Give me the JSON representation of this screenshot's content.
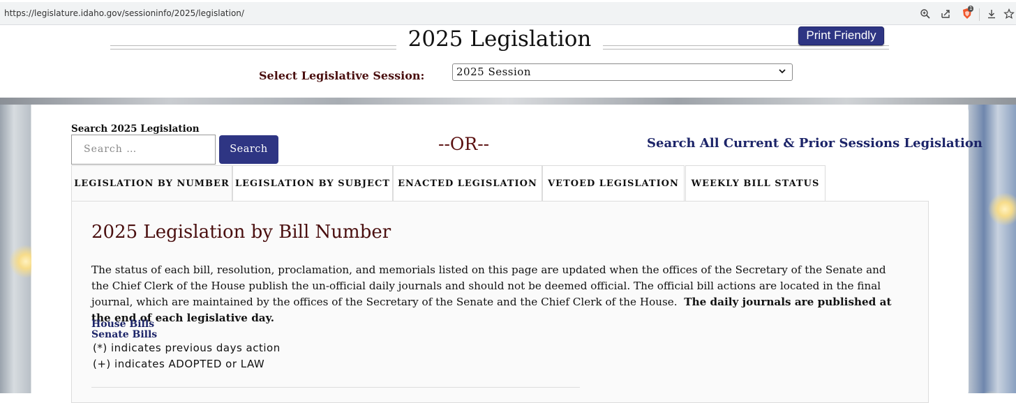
{
  "browser": {
    "url": "https://legislature.idaho.gov/sessioninfo/2025/legislation/",
    "icons": [
      "zoom-icon",
      "share-icon",
      "brave-shield-icon",
      "download-icon",
      "bookmark-icon"
    ],
    "shield_badge": "1"
  },
  "header": {
    "title": "2025 Legislation",
    "print_button": "Print Friendly",
    "session_label": "Select Legislative Session:",
    "session_value": "2025 Session"
  },
  "search": {
    "label": "Search 2025 Legislation",
    "placeholder": "Search …",
    "button": "Search",
    "or_text": "--OR--",
    "all_sessions_link": "Search All Current & Prior Sessions Legislation"
  },
  "tabs": [
    {
      "label": "LEGISLATION BY NUMBER",
      "active": true
    },
    {
      "label": "LEGISLATION BY SUBJECT",
      "active": false
    },
    {
      "label": "ENACTED LEGISLATION",
      "active": false
    },
    {
      "label": "VETOED LEGISLATION",
      "active": false
    },
    {
      "label": "WEEKLY BILL STATUS",
      "active": false
    }
  ],
  "content": {
    "title": "2025 Legislation by Bill Number",
    "paragraph": "The status of each bill, resolution, proclamation, and memorials listed on this page are updated when the offices of the Secretary of the Senate and the Chief Clerk of the House publish the un-official daily journals and should not be deemed official. The official bill actions are located in the final journal, which are maintained by the offices of the Secretary of the Senate and the Chief Clerk of the House.",
    "paragraph_bold": "The daily journals are published at the end of each legislative day.",
    "links": [
      "House Bills",
      "Senate Bills"
    ],
    "notes": [
      "(*) indicates previous days action",
      "(+) indicates ADOPTED or LAW"
    ]
  },
  "colors": {
    "accent_blue": "#2e3583",
    "maroon": "#4a0f0f",
    "link_navy": "#1c2468"
  }
}
